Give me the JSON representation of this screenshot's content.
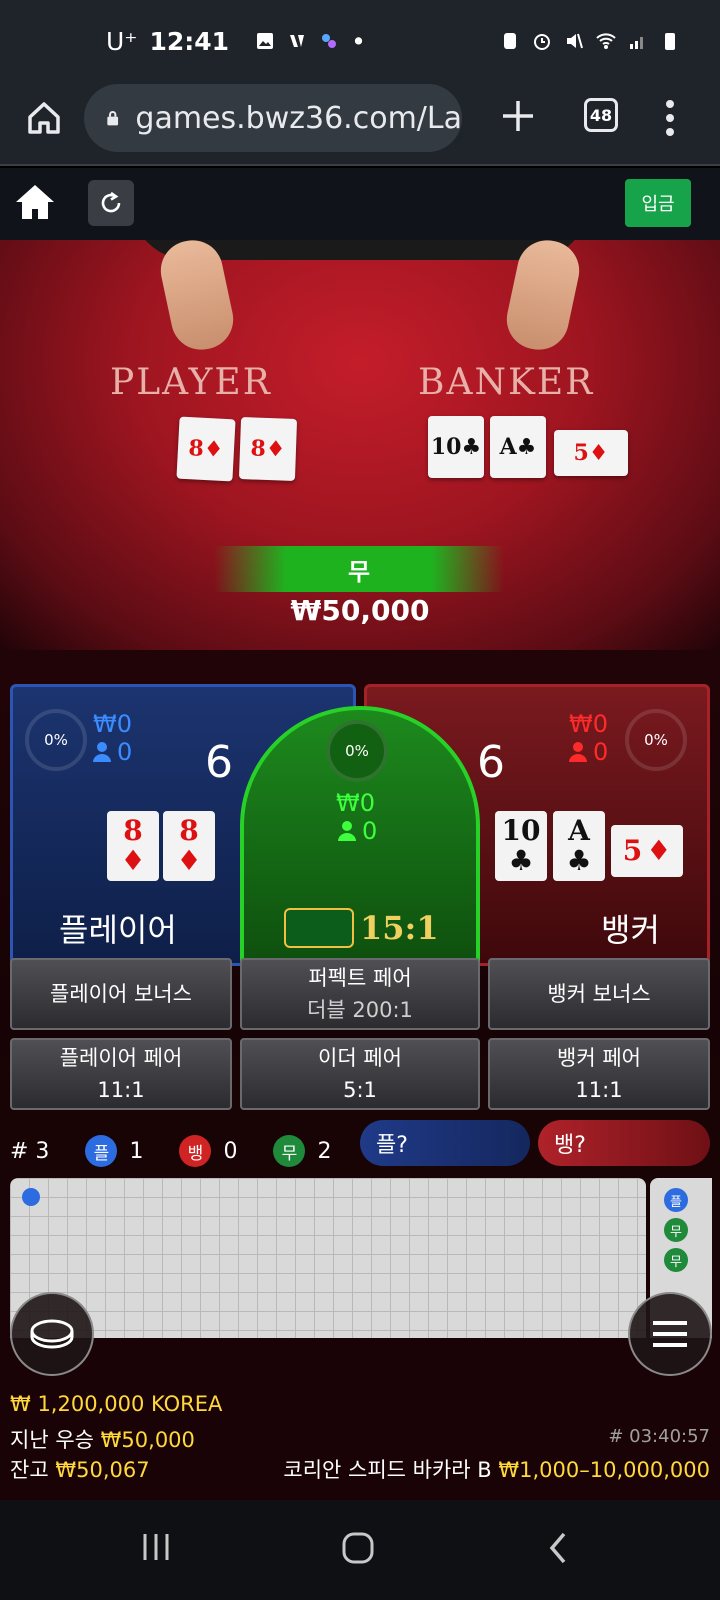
{
  "status_bar": {
    "carrier": "U⁺",
    "time": "12:41"
  },
  "browser": {
    "url": "games.bwz36.com/La",
    "tab_count": "48"
  },
  "site_toolbar": {
    "deposit_label": "입금"
  },
  "video": {
    "player_label": "PLAYER",
    "banker_label": "BANKER",
    "player_cards": [
      {
        "rank": "8",
        "suit": "♦",
        "color": "red"
      },
      {
        "rank": "8",
        "suit": "♦",
        "color": "red"
      }
    ],
    "banker_cards": [
      {
        "rank": "10",
        "suit": "♣",
        "color": "black"
      },
      {
        "rank": "A",
        "suit": "♣",
        "color": "black"
      },
      {
        "rank": "5",
        "suit": "♦",
        "color": "red"
      }
    ],
    "result": "무",
    "win_amount": "₩50,000"
  },
  "bet_panels": {
    "player": {
      "percent": "0%",
      "amount": "₩0",
      "bettors": "0",
      "score": "6",
      "label": "플레이어",
      "cards": [
        {
          "rank": "8",
          "suit": "♦"
        },
        {
          "rank": "8",
          "suit": "♦"
        }
      ]
    },
    "tie": {
      "percent": "0%",
      "amount": "₩0",
      "bettors": "0",
      "ratio": "15:1"
    },
    "banker": {
      "percent": "0%",
      "amount": "₩0",
      "bettors": "0",
      "score": "6",
      "label": "뱅커",
      "cards": [
        {
          "rank": "10",
          "suit": "♣"
        },
        {
          "rank": "A",
          "suit": "♣"
        },
        {
          "rank": "5",
          "suit": "♦"
        }
      ]
    }
  },
  "side_bets": {
    "player_bonus": "플레이어 보너스",
    "perfect_pair": "퍼펙트 페어",
    "perfect_pair_sub": "더블 200:1",
    "banker_bonus": "뱅커 보너스",
    "player_pair": "플레이어 페어",
    "player_pair_sub": "11:1",
    "either_pair": "이더 페어",
    "either_pair_sub": "5:1",
    "banker_pair": "뱅커 페어",
    "banker_pair_sub": "11:1"
  },
  "counts": {
    "round": "# 3",
    "player_char": "플",
    "player_count": "1",
    "banker_char": "뱅",
    "banker_count": "0",
    "tie_char": "무",
    "tie_count": "2",
    "player_ask": "플?",
    "banker_ask": "뱅?"
  },
  "roadmap_mini": [
    "플",
    "무",
    "무"
  ],
  "footer": {
    "jackpot": "₩ 1,200,000 KOREA",
    "last_win_label": "지난 우승",
    "last_win_amount": "₩50,000",
    "balance_label": "잔고",
    "balance_amount": "₩50,067",
    "game_id": "# 03:40:57",
    "table_name": "코리안 스피드 바카라 B",
    "bet_limits": "₩1,000–10,000,000"
  },
  "colors": {
    "player_blue": "#2d55b4",
    "banker_red": "#a52228",
    "tie_green": "#27d127",
    "accent_yellow": "#ffd83a",
    "deposit_green": "#16a34a"
  }
}
